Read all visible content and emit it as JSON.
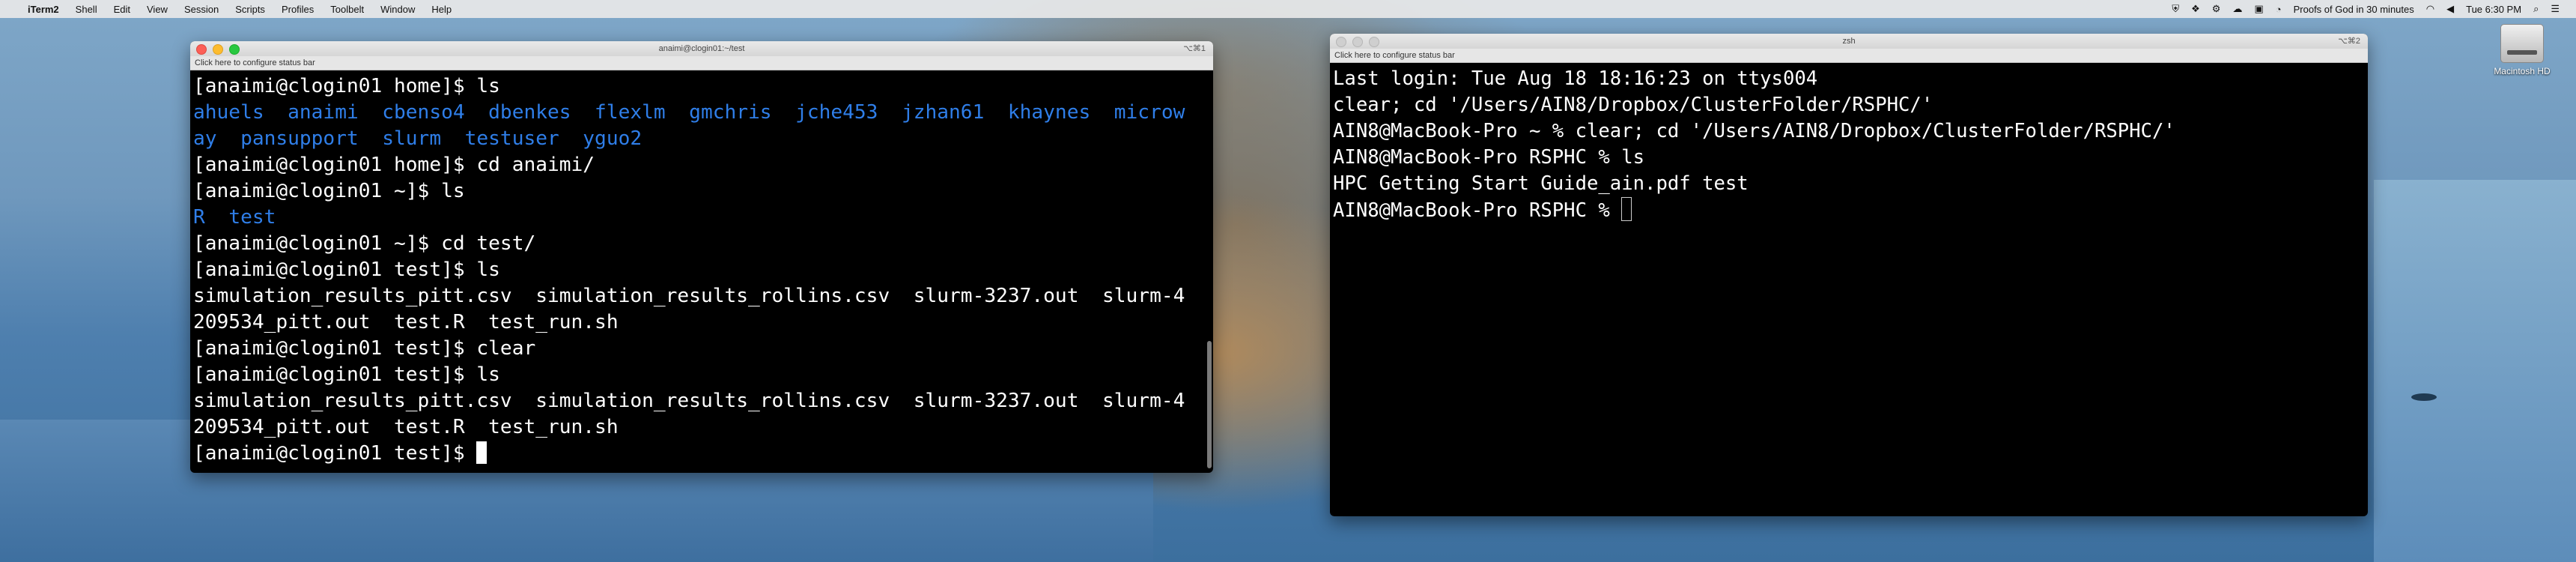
{
  "menubar": {
    "app_name": "iTerm2",
    "items": [
      "Shell",
      "Edit",
      "View",
      "Session",
      "Scripts",
      "Profiles",
      "Toolbelt",
      "Window",
      "Help"
    ],
    "status_text": "Proofs of God in 30 minutes",
    "clock": "Tue 6:30 PM"
  },
  "desktop": {
    "disk_label": "Macintosh HD"
  },
  "window_left": {
    "title": "anaimi@clogin01:~/test",
    "shortcut": "⌥⌘1",
    "status_bar": "Click here to configure status bar",
    "lines": [
      [
        {
          "t": "[anaimi@clogin01 home]$ ls",
          "c": ""
        }
      ],
      [
        {
          "t": "ahuels  anaimi  cbenso4  dbenkes  flexlm  gmchris  jche453  jzhan61  khaynes  microw",
          "c": "blue"
        }
      ],
      [
        {
          "t": "ay  pansupport  slurm  testuser  yguo2",
          "c": "blue"
        }
      ],
      [
        {
          "t": "[anaimi@clogin01 home]$ cd anaimi/",
          "c": ""
        }
      ],
      [
        {
          "t": "[anaimi@clogin01 ~]$ ls",
          "c": ""
        }
      ],
      [
        {
          "t": "R",
          "c": "blue"
        },
        {
          "t": "  ",
          "c": ""
        },
        {
          "t": "test",
          "c": "blue"
        }
      ],
      [
        {
          "t": "[anaimi@clogin01 ~]$ cd test/",
          "c": ""
        }
      ],
      [
        {
          "t": "[anaimi@clogin01 test]$ ls",
          "c": ""
        }
      ],
      [
        {
          "t": "simulation_results_pitt.csv  simulation_results_rollins.csv  slurm-3237.out  slurm-4",
          "c": ""
        }
      ],
      [
        {
          "t": "209534_pitt.out  test.R  test_run.sh",
          "c": ""
        }
      ],
      [
        {
          "t": "[anaimi@clogin01 test]$ clear",
          "c": ""
        }
      ],
      [
        {
          "t": "[anaimi@clogin01 test]$ ls",
          "c": ""
        }
      ],
      [
        {
          "t": "simulation_results_pitt.csv  simulation_results_rollins.csv  slurm-3237.out  slurm-4",
          "c": ""
        }
      ],
      [
        {
          "t": "209534_pitt.out  test.R  test_run.sh",
          "c": ""
        }
      ],
      [
        {
          "t": "[anaimi@clogin01 test]$ ",
          "c": ""
        }
      ]
    ]
  },
  "window_right": {
    "title": "zsh",
    "shortcut": "⌥⌘2",
    "status_bar": "Click here to configure status bar",
    "lines": [
      [
        {
          "t": "Last login: Tue Aug 18 18:16:23 on ttys004",
          "c": ""
        }
      ],
      [
        {
          "t": "clear; cd '/Users/AIN8/Dropbox/ClusterFolder/RSPHC/'",
          "c": ""
        }
      ],
      [
        {
          "t": "AIN8@MacBook-Pro ~ % clear; cd '/Users/AIN8/Dropbox/ClusterFolder/RSPHC/'",
          "c": ""
        }
      ],
      [
        {
          "t": "AIN8@MacBook-Pro RSPHC % ls",
          "c": ""
        }
      ],
      [
        {
          "t": "HPC Getting Start Guide_ain.pdf test",
          "c": ""
        }
      ],
      [
        {
          "t": "AIN8@MacBook-Pro RSPHC % ",
          "c": ""
        }
      ]
    ]
  },
  "icons": {
    "apple": "apple-logo-icon",
    "status_icons": [
      "shield-icon",
      "dropbox-icon",
      "gear-icon",
      "cloud-icon",
      "lock-icon",
      "bell-icon",
      "spotlight-icon",
      "menu-icon"
    ]
  }
}
